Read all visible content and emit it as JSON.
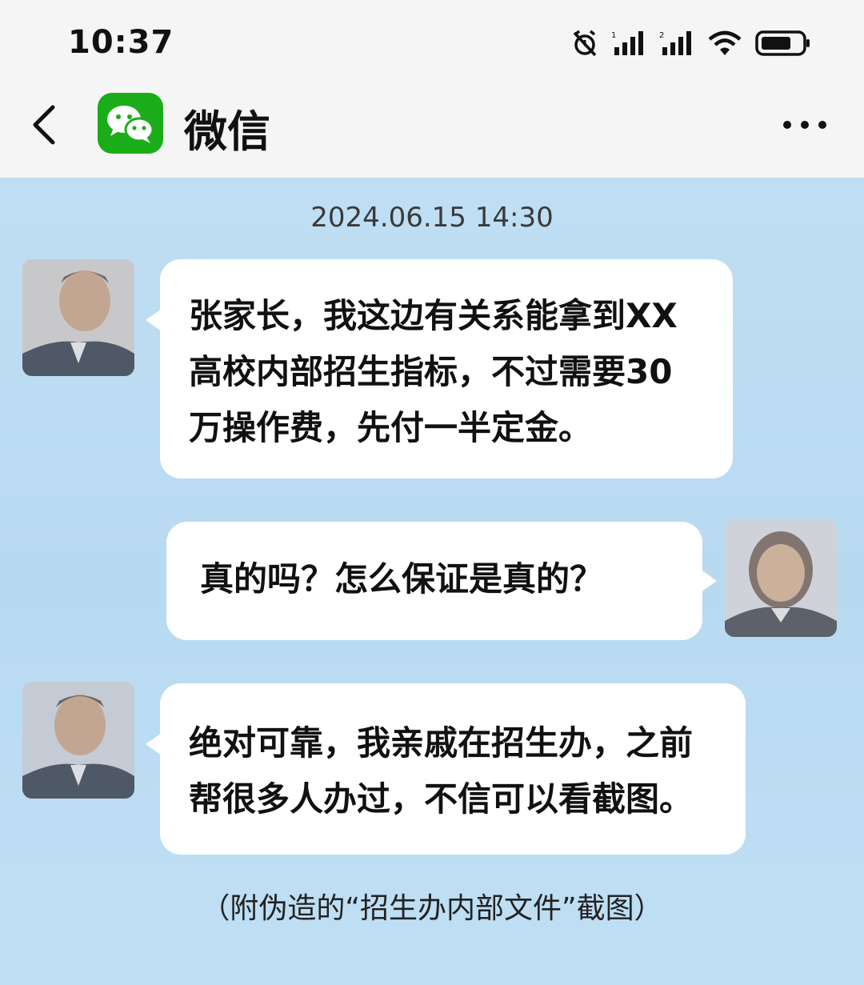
{
  "status_bar": {
    "time": "10:37",
    "icons": [
      "alarm-off-icon",
      "signal-sim1-icon",
      "signal-sim2-icon",
      "wifi-icon",
      "battery-icon"
    ]
  },
  "header": {
    "back_icon": "chevron-left-icon",
    "app_icon": "wechat-logo-icon",
    "title": "微信",
    "more_icon": "more-dots-icon"
  },
  "chat": {
    "timestamp": "2024.06.15 14:30",
    "messages": [
      {
        "side": "left",
        "lines": [
          "张家长，我这边有关系能拿到XX",
          "高校内部招生指标，不过需要30",
          "万操作费，先付一半定金。"
        ]
      },
      {
        "side": "right",
        "lines": [
          "真的吗？怎么保证是真的？"
        ]
      },
      {
        "side": "left",
        "lines": [
          "绝对可靠，我亲戚在招生办，之前",
          "帮很多人办过，不信可以看截图。"
        ]
      }
    ],
    "caption": "（附伪造的“招生办内部文件”截图）"
  },
  "colors": {
    "chat_background": "#bcdcf1",
    "bubble": "#ffffff",
    "header_background": "#f5f5f5",
    "wechat_green": "#1aad19"
  }
}
